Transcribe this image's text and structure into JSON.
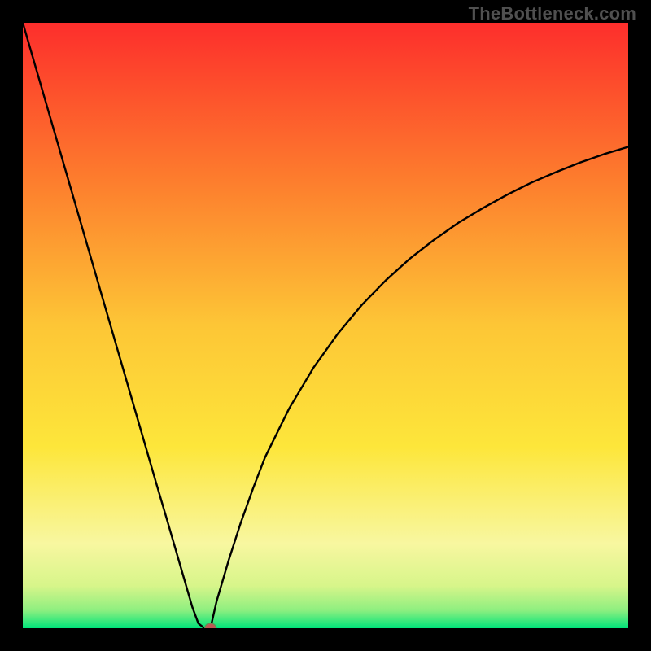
{
  "watermark": "TheBottleneck.com",
  "colors": {
    "frame": "#000000",
    "curve": "#000000",
    "marker_fill": "#be5a55",
    "marker_stroke": "#5e9453",
    "grad_top": "#fd2e2c",
    "grad_mid": "#fde63a",
    "grad_bottom": "#00e47a"
  },
  "chart_data": {
    "type": "line",
    "title": "",
    "xlabel": "",
    "ylabel": "",
    "xlim": [
      0,
      100
    ],
    "ylim": [
      0,
      100
    ],
    "grid": false,
    "legend": false,
    "x": [
      0,
      2,
      4,
      6,
      8,
      10,
      12,
      14,
      16,
      18,
      20,
      22,
      24,
      26,
      28,
      29,
      30,
      31,
      32,
      34,
      36,
      38,
      40,
      44,
      48,
      52,
      56,
      60,
      64,
      68,
      72,
      76,
      80,
      84,
      88,
      92,
      96,
      100
    ],
    "y": [
      100,
      93.1,
      86.2,
      79.3,
      72.4,
      65.5,
      58.6,
      51.7,
      44.8,
      37.9,
      31.0,
      24.1,
      17.3,
      10.4,
      3.5,
      0.8,
      0.0,
      0.0,
      4.4,
      11.2,
      17.4,
      23.0,
      28.2,
      36.3,
      43.0,
      48.6,
      53.4,
      57.5,
      61.1,
      64.2,
      67.0,
      69.4,
      71.6,
      73.6,
      75.3,
      76.9,
      78.3,
      79.5
    ],
    "marker": {
      "x": 31,
      "y": 0
    },
    "notes": "V-shaped bottleneck curve; minimum ~0% near x≈30, right branch asymptotes near ~80%."
  }
}
